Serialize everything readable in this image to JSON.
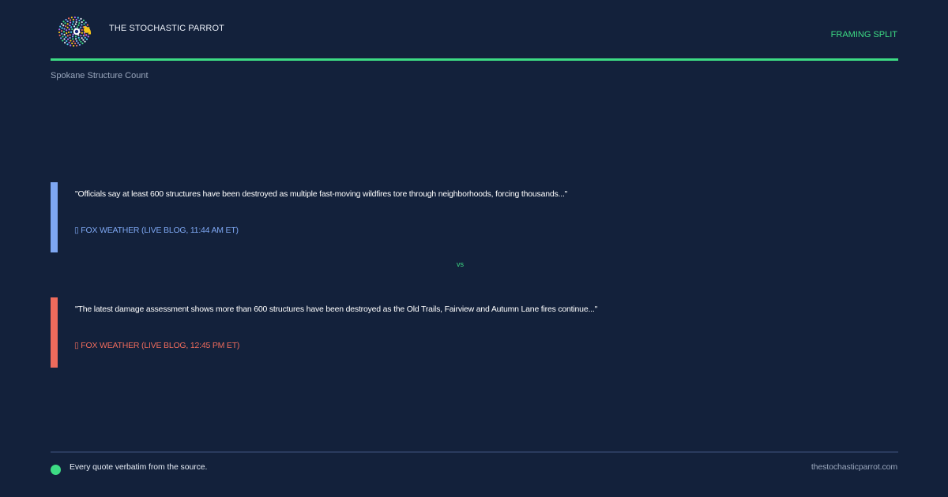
{
  "header": {
    "brand": "THE STOCHASTIC PARROT",
    "tag": "FRAMING SPLIT",
    "subtitle": "Spokane Structure Count"
  },
  "colors": {
    "background": "#13213b",
    "accent": "#3ddc84",
    "quote_a": "#7ea7f2",
    "quote_b": "#ee6b5c"
  },
  "quotes": [
    {
      "text": "\"Officials say at least 600 structures have been destroyed as multiple fast-moving wildfires tore through neighborhoods, forcing thousands...\"",
      "source": "▯ FOX WEATHER (LIVE BLOG, 11:44 AM ET)"
    },
    {
      "text": "\"The latest damage assessment shows more than 600 structures have been destroyed as the Old Trails, Fairview and Autumn Lane fires continue...\"",
      "source": "▯ FOX WEATHER (LIVE BLOG, 12:45 PM ET)"
    }
  ],
  "separator": "vs",
  "footer": {
    "note": "Every quote verbatim from the source.",
    "url": "thestochasticparrot.com"
  }
}
